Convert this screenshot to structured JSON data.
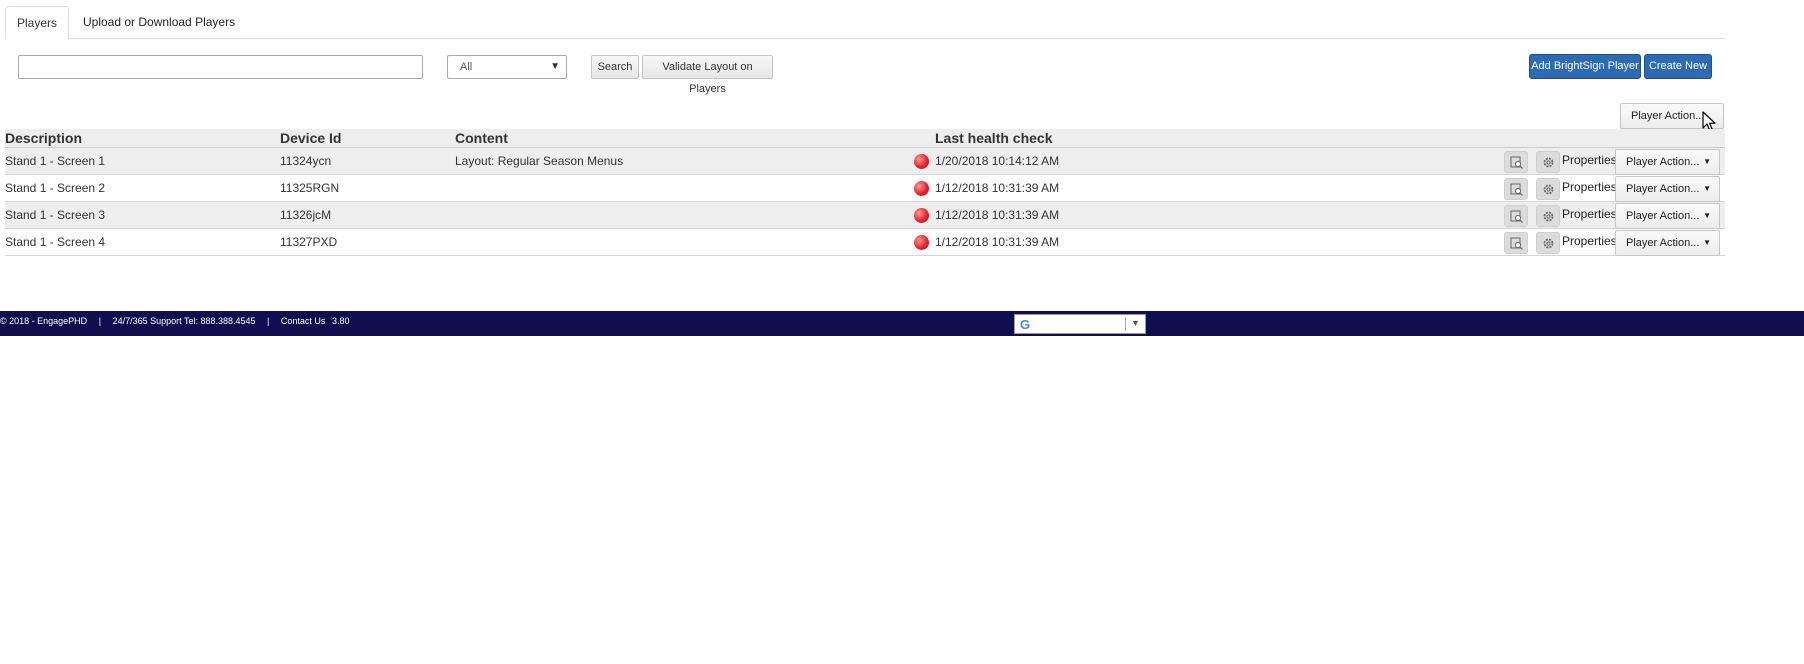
{
  "tabs": [
    {
      "label": "Players",
      "active": true
    },
    {
      "label": "Upload or Download Players",
      "active": false
    }
  ],
  "search": {
    "value": "",
    "placeholder": ""
  },
  "filter": {
    "selected": "All"
  },
  "toolbar": {
    "search_label": "Search",
    "validate_label": "Validate Layout on Players",
    "add_label": "Add BrightSign Player",
    "create_label": "Create New",
    "player_action_label": "Player Action..."
  },
  "table": {
    "headers": [
      "Description",
      "Device Id",
      "Content",
      "Last health check"
    ],
    "rows": [
      {
        "description": "Stand 1 - Screen 1",
        "device_id": "11324ycn",
        "content": "Layout: Regular Season Menus",
        "health": "1/20/2018 10:14:12 AM",
        "status": "offline",
        "properties_label": "Properties",
        "action_label": "Player Action..."
      },
      {
        "description": "Stand 1 - Screen 2",
        "device_id": "11325RGN",
        "content": "",
        "health": "1/12/2018 10:31:39 AM",
        "status": "offline",
        "properties_label": "Properties",
        "action_label": "Player Action..."
      },
      {
        "description": "Stand 1 - Screen 3",
        "device_id": "11326jcM",
        "content": "",
        "health": "1/12/2018 10:31:39 AM",
        "status": "offline",
        "properties_label": "Properties",
        "action_label": "Player Action..."
      },
      {
        "description": "Stand 1 - Screen 4",
        "device_id": "11327PXD",
        "content": "",
        "health": "1/12/2018 10:31:39 AM",
        "status": "offline",
        "properties_label": "Properties",
        "action_label": "Player Action..."
      }
    ]
  },
  "footer": {
    "copyright": "© 2018 - EngagePHD",
    "divider": "|",
    "support": "24/7/365 Support Tel: 888.388.4545",
    "contact": "Contact Us",
    "version": "3.80"
  },
  "colors": {
    "primary_button": "#2c6bb4",
    "footer_bg": "#0f0f4f",
    "status_offline": "#e8222a",
    "row_alt": "#eeeeee"
  },
  "icons": {
    "preview": "preview-icon",
    "settings": "gear-icon",
    "status": "status-dot-icon",
    "dropdown": "caret-down-icon",
    "translate": "google-g-icon"
  }
}
